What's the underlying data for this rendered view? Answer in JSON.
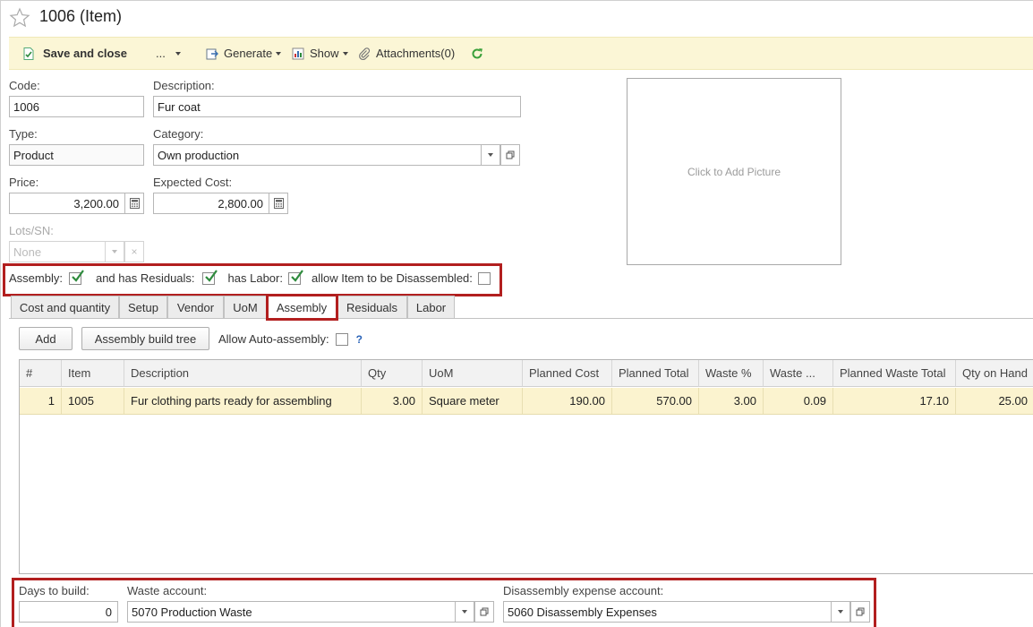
{
  "window": {
    "title": "1006 (Item)"
  },
  "toolbar": {
    "save_close": "Save and close",
    "more": "...",
    "generate": "Generate",
    "show": "Show",
    "attachments": "Attachments(0)"
  },
  "form": {
    "code_label": "Code:",
    "code_value": "1006",
    "description_label": "Description:",
    "description_value": "Fur coat",
    "type_label": "Type:",
    "type_value": "Product",
    "category_label": "Category:",
    "category_value": "Own production",
    "price_label": "Price:",
    "price_value": "3,200.00",
    "expected_cost_label": "Expected Cost:",
    "expected_cost_value": "2,800.00",
    "lots_label": "Lots/SN:",
    "lots_value": "None"
  },
  "picture": {
    "placeholder": "Click to Add Picture"
  },
  "flags": {
    "assembly_label": "Assembly:",
    "assembly_checked": true,
    "residuals_label": "and has Residuals:",
    "residuals_checked": true,
    "labor_label": "has Labor:",
    "labor_checked": true,
    "disassemble_label": "allow Item to be Disassembled:",
    "disassemble_checked": false
  },
  "tabs": [
    {
      "label": "Cost and quantity",
      "active": false
    },
    {
      "label": "Setup",
      "active": false
    },
    {
      "label": "Vendor",
      "active": false
    },
    {
      "label": "UoM",
      "active": false
    },
    {
      "label": "Assembly",
      "active": true
    },
    {
      "label": "Residuals",
      "active": false
    },
    {
      "label": "Labor",
      "active": false
    }
  ],
  "assembly": {
    "add_button": "Add",
    "build_tree_button": "Assembly build tree",
    "auto_assembly_label": "Allow Auto-assembly:",
    "auto_assembly_checked": false,
    "help": "?"
  },
  "table": {
    "columns": [
      "#",
      "Item",
      "Description",
      "Qty",
      "UoM",
      "Planned Cost",
      "Planned Total",
      "Waste %",
      "Waste ...",
      "Planned Waste Total",
      "Qty on Hand"
    ],
    "rows": [
      [
        "1",
        "1005",
        "Fur clothing parts ready for assembling",
        "3.00",
        "Square meter",
        "190.00",
        "570.00",
        "3.00",
        "0.09",
        "17.10",
        "25.00"
      ]
    ]
  },
  "footer": {
    "days_label": "Days to build:",
    "days_value": "0",
    "waste_label": "Waste account:",
    "waste_value": "5070 Production Waste",
    "disassembly_label": "Disassembly expense account:",
    "disassembly_value": "5060 Disassembly Expenses"
  },
  "colors": {
    "toolbar_bg": "#fbf6d6",
    "highlight": "#b21f1f",
    "row_selected": "#fbf3cf",
    "check": "#2e8b3d",
    "refresh": "#3aa03a"
  }
}
